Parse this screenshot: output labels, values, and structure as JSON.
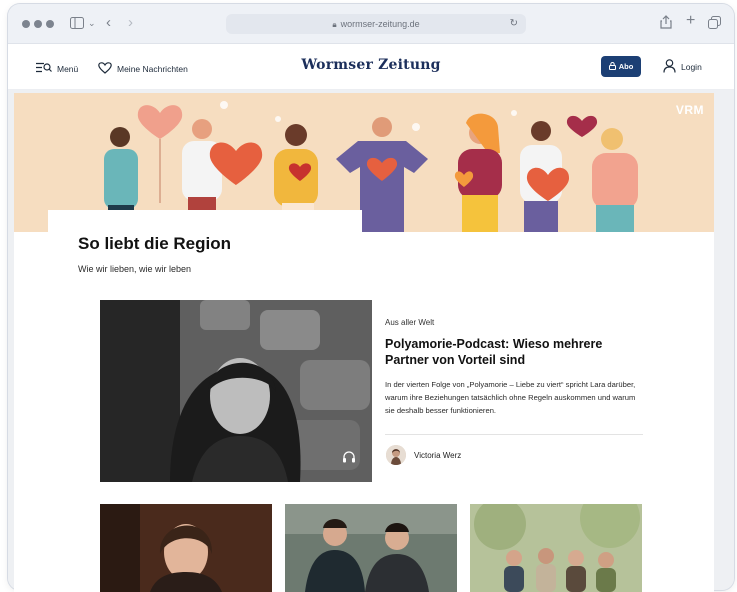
{
  "browser": {
    "url": "wormser-zeitung.de",
    "icons": {
      "sidebar": "sidebar-icon",
      "back": "chevron-left-icon",
      "forward": "chevron-right-icon",
      "share": "share-icon",
      "new_tab": "plus-icon",
      "tabs": "tabs-overview-icon",
      "reload": "reload-icon",
      "lock": "lock-icon"
    }
  },
  "header": {
    "menu_label": "Menü",
    "messages_label": "Meine Nachrichten",
    "logo": "Wormser Zeitung",
    "abo_label": "Abo",
    "login_label": "Login",
    "brand_color": "#1c3f74"
  },
  "hero": {
    "badge": "VRM",
    "background_color": "#f6ddc0"
  },
  "section": {
    "title": "So liebt die Region",
    "subtitle": "Wie wir lieben, wie wir leben"
  },
  "feature": {
    "kicker": "Aus aller Welt",
    "headline": "Polyamorie-Podcast: Wieso mehrere Partner von Vorteil sind",
    "teaser": "In der vierten Folge von „Polyamorie – Liebe zu viert“ spricht Lara darüber, warum ihre Beziehungen tatsächlich ohne Regeln auskommen und warum sie deshalb besser funktionieren.",
    "author": "Victoria Werz",
    "media_icon": "headphones-icon"
  },
  "teasers": [
    {
      "image": "portrait-woman-photo"
    },
    {
      "image": "two-men-photo"
    },
    {
      "image": "group-outdoor-photo"
    }
  ]
}
